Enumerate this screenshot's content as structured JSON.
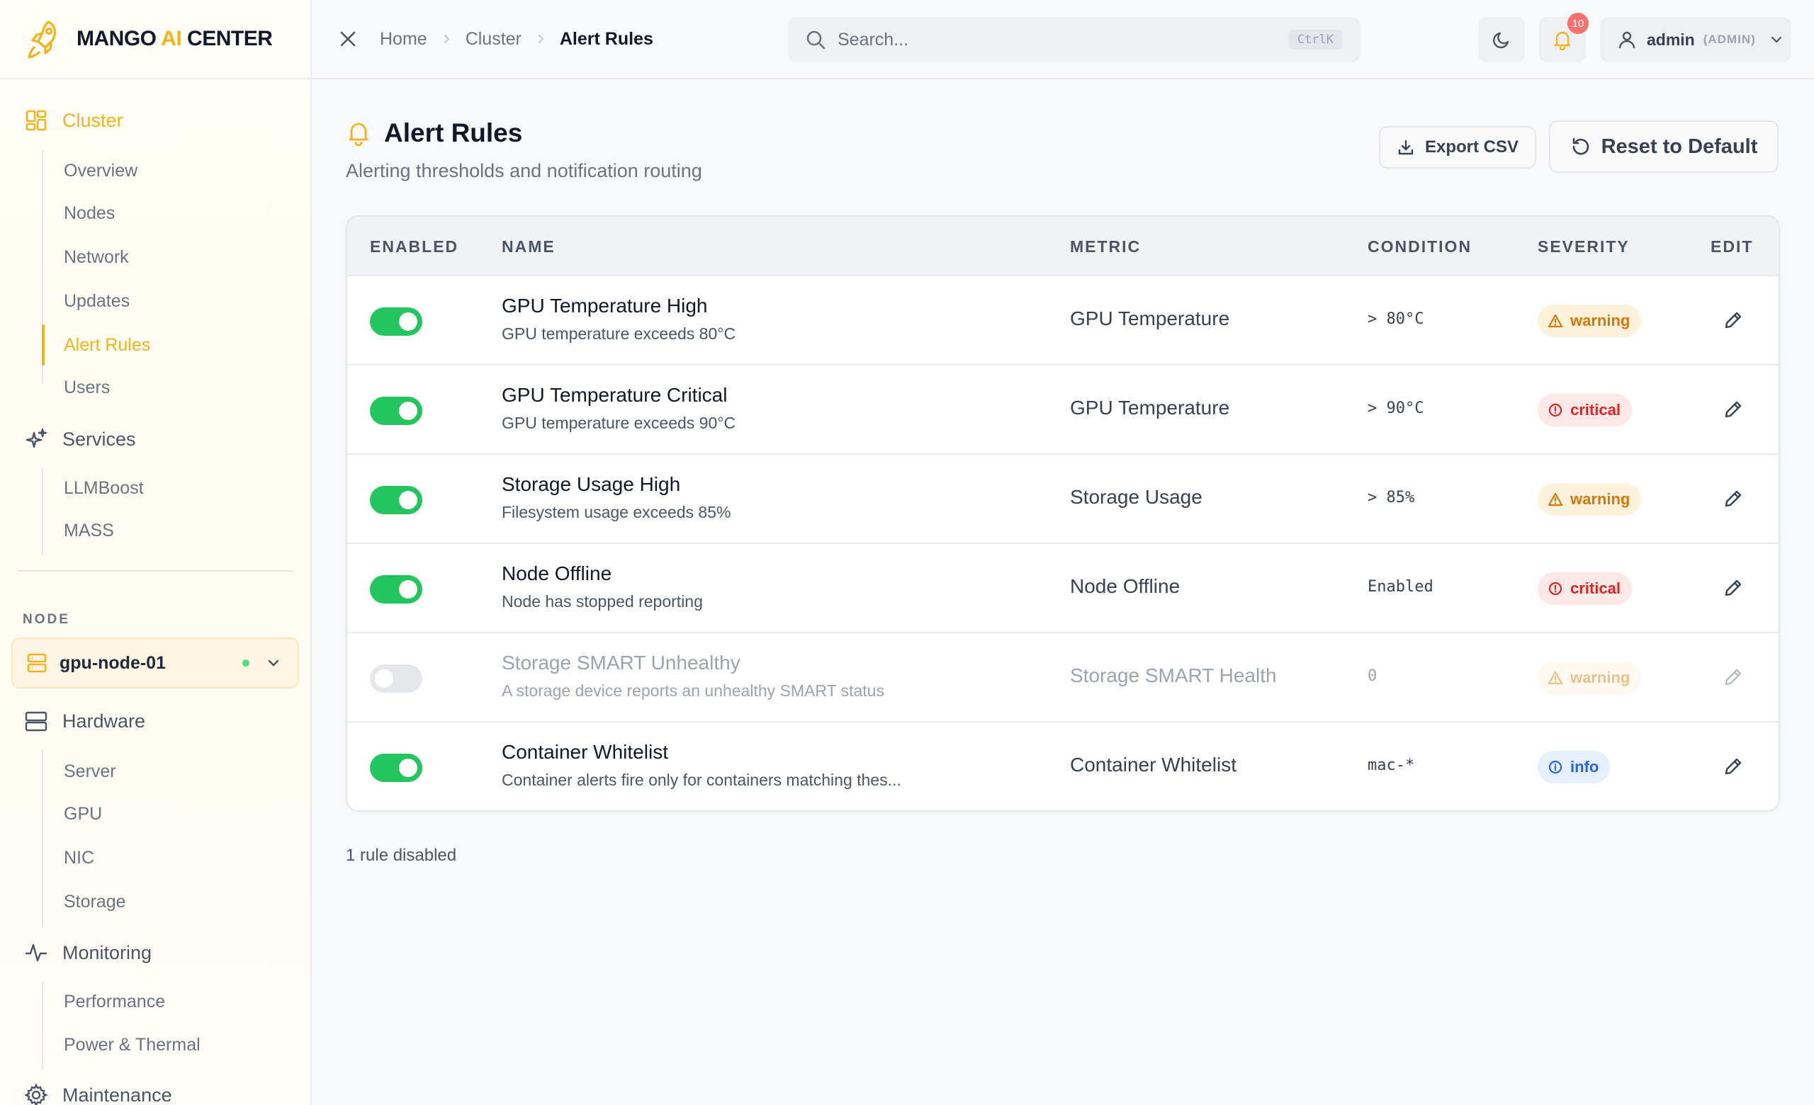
{
  "brand": {
    "name_part1": "MANGO ",
    "name_ai": "AI",
    "name_part2": " CENTER"
  },
  "sidebar": {
    "cluster": {
      "label": "Cluster",
      "items": [
        "Overview",
        "Nodes",
        "Network",
        "Updates",
        "Alert Rules",
        "Users"
      ],
      "active": "Alert Rules"
    },
    "services": {
      "label": "Services",
      "items": [
        "LLMBoost",
        "MASS"
      ]
    },
    "node_section_label": "NODE",
    "node_select": {
      "value": "gpu-node-01"
    },
    "hardware": {
      "label": "Hardware",
      "items": [
        "Server",
        "GPU",
        "NIC",
        "Storage"
      ]
    },
    "monitoring": {
      "label": "Monitoring",
      "items": [
        "Performance",
        "Power & Thermal"
      ]
    },
    "maintenance": {
      "label": "Maintenance"
    }
  },
  "topbar": {
    "breadcrumbs": [
      "Home",
      "Cluster",
      "Alert Rules"
    ],
    "search": {
      "placeholder": "Search...",
      "shortcut": "CtrlK"
    },
    "notifications_count": "10",
    "user": {
      "name": "admin",
      "role": "(ADMIN)"
    }
  },
  "page": {
    "title": "Alert Rules",
    "subtitle": "Alerting thresholds and notification routing",
    "export_label": "Export CSV",
    "reset_label": "Reset to Default"
  },
  "table": {
    "headers": [
      "ENABLED",
      "NAME",
      "METRIC",
      "CONDITION",
      "SEVERITY",
      "EDIT"
    ],
    "rows": [
      {
        "enabled": true,
        "name": "GPU Temperature High",
        "desc": "GPU temperature exceeds 80°C",
        "metric": "GPU Temperature",
        "condition": "> 80°C",
        "severity": "warning"
      },
      {
        "enabled": true,
        "name": "GPU Temperature Critical",
        "desc": "GPU temperature exceeds 90°C",
        "metric": "GPU Temperature",
        "condition": "> 90°C",
        "severity": "critical"
      },
      {
        "enabled": true,
        "name": "Storage Usage High",
        "desc": "Filesystem usage exceeds 85%",
        "metric": "Storage Usage",
        "condition": "> 85%",
        "severity": "warning"
      },
      {
        "enabled": true,
        "name": "Node Offline",
        "desc": "Node has stopped reporting",
        "metric": "Node Offline",
        "condition": "Enabled",
        "severity": "critical"
      },
      {
        "enabled": false,
        "name": "Storage SMART Unhealthy",
        "desc": "A storage device reports an unhealthy SMART status",
        "metric": "Storage SMART Health",
        "condition": "0",
        "severity": "warning"
      },
      {
        "enabled": true,
        "name": "Container Whitelist",
        "desc": "Container alerts fire only for containers matching thes...",
        "metric": "Container Whitelist",
        "condition": "mac-*",
        "severity": "info"
      }
    ]
  },
  "footer_note": "1 rule disabled",
  "colors": {
    "accent": "#f5b21c",
    "toggle_on": "#22c55e",
    "warning": "#d97706",
    "critical": "#dc2626",
    "info": "#2563eb"
  }
}
